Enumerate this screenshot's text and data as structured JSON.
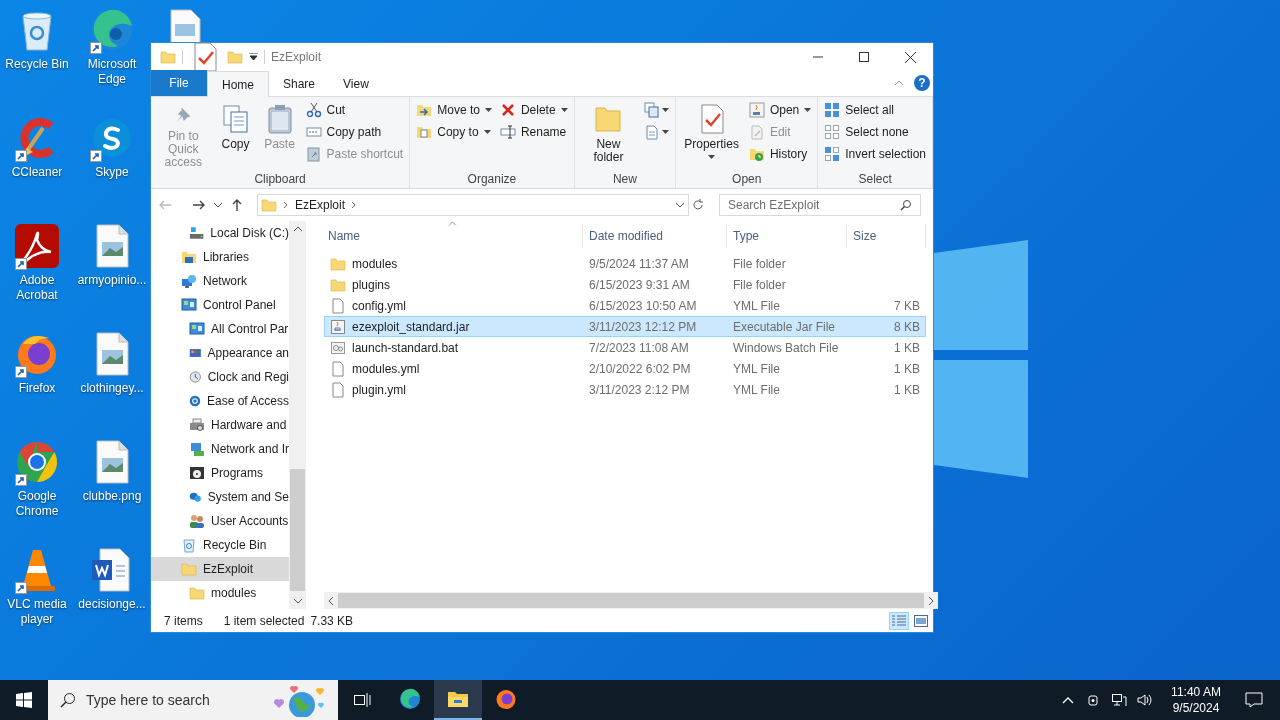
{
  "desktop_icons": [
    {
      "label": "Recycle Bin",
      "kind": "recycle",
      "shortcut": false
    },
    {
      "label": "Microsoft Edge",
      "kind": "edge",
      "shortcut": true
    },
    {
      "label": "CCleaner",
      "kind": "ccleaner",
      "shortcut": true
    },
    {
      "label": "Skype",
      "kind": "skype",
      "shortcut": true
    },
    {
      "label": "Adobe Acrobat",
      "kind": "acrobat",
      "shortcut": true
    },
    {
      "label": "armyopinio...",
      "kind": "image",
      "shortcut": false
    },
    {
      "label": "Firefox",
      "kind": "firefox",
      "shortcut": true
    },
    {
      "label": "clothingey...",
      "kind": "image",
      "shortcut": false
    },
    {
      "label": "Google Chrome",
      "kind": "chrome",
      "shortcut": true
    },
    {
      "label": "clubbe.png",
      "kind": "image",
      "shortcut": false
    },
    {
      "label": "VLC media player",
      "kind": "vlc",
      "shortcut": true
    },
    {
      "label": "decisionge...",
      "kind": "word",
      "shortcut": false
    }
  ],
  "window": {
    "title": "EzExploit",
    "tabs": [
      {
        "label": "File",
        "kind": "file",
        "selected": false
      },
      {
        "label": "Home",
        "kind": "tab",
        "selected": true
      },
      {
        "label": "Share",
        "kind": "tab",
        "selected": false
      },
      {
        "label": "View",
        "kind": "tab",
        "selected": false
      }
    ],
    "help": "?",
    "ribbon": [
      {
        "label": "Clipboard",
        "columns": [
          [
            {
              "kind": "large",
              "label": "Pin to Quick access",
              "disabled": true,
              "dropdown": false
            }
          ],
          [
            {
              "kind": "large",
              "label": "Copy",
              "disabled": false,
              "dropdown": false
            }
          ],
          [
            {
              "kind": "large",
              "label": "Paste",
              "disabled": true,
              "dropdown": false
            }
          ],
          [
            {
              "kind": "small",
              "label": "Cut",
              "disabled": false,
              "dropdown": false
            },
            {
              "kind": "small",
              "label": "Copy path",
              "disabled": false,
              "dropdown": false
            },
            {
              "kind": "small",
              "label": "Paste shortcut",
              "disabled": true,
              "dropdown": false
            }
          ]
        ]
      },
      {
        "label": "Organize",
        "columns": [
          [
            {
              "kind": "small",
              "label": "Move to",
              "disabled": false,
              "dropdown": true
            },
            {
              "kind": "small",
              "label": "Copy to",
              "disabled": false,
              "dropdown": true
            }
          ],
          [
            {
              "kind": "small",
              "label": "Delete",
              "disabled": false,
              "dropdown": true
            },
            {
              "kind": "small",
              "label": "Rename",
              "disabled": false,
              "dropdown": false
            }
          ]
        ]
      },
      {
        "label": "New",
        "columns": [
          [
            {
              "kind": "large",
              "label": "New folder",
              "disabled": false,
              "dropdown": false
            }
          ],
          [
            {
              "kind": "icon",
              "disabled": false,
              "dropdown": true
            },
            {
              "kind": "icon",
              "disabled": false,
              "dropdown": true
            }
          ]
        ]
      },
      {
        "label": "Open",
        "columns": [
          [
            {
              "kind": "large",
              "label": "Properties",
              "disabled": false,
              "dropdown": true
            }
          ],
          [
            {
              "kind": "small",
              "label": "Open",
              "disabled": false,
              "dropdown": true
            },
            {
              "kind": "small",
              "label": "Edit",
              "disabled": true,
              "dropdown": false
            },
            {
              "kind": "small",
              "label": "History",
              "disabled": false,
              "dropdown": false
            }
          ]
        ]
      },
      {
        "label": "Select",
        "columns": [
          [
            {
              "kind": "small",
              "label": "Select all",
              "disabled": false,
              "dropdown": false
            },
            {
              "kind": "small",
              "label": "Select none",
              "disabled": false,
              "dropdown": false
            },
            {
              "kind": "small",
              "label": "Invert selection",
              "disabled": false,
              "dropdown": false
            }
          ]
        ]
      }
    ],
    "path": [
      "EzExploit"
    ],
    "search_placeholder": "Search EzExploit",
    "nav_tree": [
      {
        "children": [
          {
            "label": "Local Disk (C:)",
            "kind": "drive",
            "selected": false
          }
        ]
      },
      {
        "label": "Libraries",
        "kind": "library",
        "selected": false
      },
      {
        "label": "Network",
        "kind": "network",
        "selected": false
      },
      {
        "label": "Control Panel",
        "kind": "control",
        "selected": false,
        "children": [
          {
            "label": "All Control Par",
            "kind": "control",
            "selected": false
          },
          {
            "label": "Appearance an",
            "kind": "appearance",
            "selected": false
          },
          {
            "label": "Clock and Regi",
            "kind": "clock",
            "selected": false
          },
          {
            "label": "Ease of Access",
            "kind": "ease",
            "selected": false
          },
          {
            "label": "Hardware and",
            "kind": "hardware",
            "selected": false
          },
          {
            "label": "Network and Ir",
            "kind": "netctl",
            "selected": false
          },
          {
            "label": "Programs",
            "kind": "programs",
            "selected": false
          },
          {
            "label": "System and Se",
            "kind": "system",
            "selected": false
          },
          {
            "label": "User Accounts",
            "kind": "users",
            "selected": false
          }
        ]
      },
      {
        "label": "Recycle Bin",
        "kind": "recycle",
        "selected": false
      },
      {
        "label": "EzExploit",
        "kind": "folder",
        "selected": true,
        "children": [
          {
            "label": "modules",
            "kind": "folder",
            "selected": false
          }
        ]
      }
    ],
    "columns": [
      "Name",
      "Date modified",
      "Type",
      "Size"
    ],
    "files": [
      {
        "name": "modules",
        "date": "9/5/2024 11:37 AM",
        "type": "File folder",
        "kind": "folder",
        "selected": false
      },
      {
        "name": "plugins",
        "date": "6/15/2023 9:31 AM",
        "type": "File folder",
        "kind": "folder",
        "selected": false
      },
      {
        "name": "config.yml",
        "date": "6/15/2023 10:50 AM",
        "type": "YML File",
        "size": "7 KB",
        "kind": "file",
        "selected": false
      },
      {
        "name": "ezexploit_standard.jar",
        "date": "3/11/2023 12:12 PM",
        "type": "Executable Jar File",
        "size": "8 KB",
        "kind": "jar",
        "selected": true
      },
      {
        "name": "launch-standard.bat",
        "date": "7/2/2023 11:08 AM",
        "type": "Windows Batch File",
        "size": "1 KB",
        "kind": "bat",
        "selected": false
      },
      {
        "name": "modules.yml",
        "date": "2/10/2022 6:02 PM",
        "type": "YML File",
        "size": "1 KB",
        "kind": "file",
        "selected": false
      },
      {
        "name": "plugin.yml",
        "date": "3/11/2023 2:12 PM",
        "type": "YML File",
        "size": "1 KB",
        "kind": "file",
        "selected": false
      }
    ],
    "status": {
      "count": "7 items",
      "selection": "1 item selected",
      "size": "7.33 KB"
    },
    "views": [
      {
        "kind": "details",
        "selected": true
      },
      {
        "kind": "large",
        "selected": false
      }
    ]
  },
  "taskbar": {
    "search_placeholder": "Type here to search",
    "apps": [
      {
        "kind": "edge",
        "active": false
      },
      {
        "kind": "explorer",
        "active": true
      },
      {
        "kind": "firefox",
        "active": false
      }
    ],
    "time": "11:40 AM",
    "date": "9/5/2024"
  }
}
